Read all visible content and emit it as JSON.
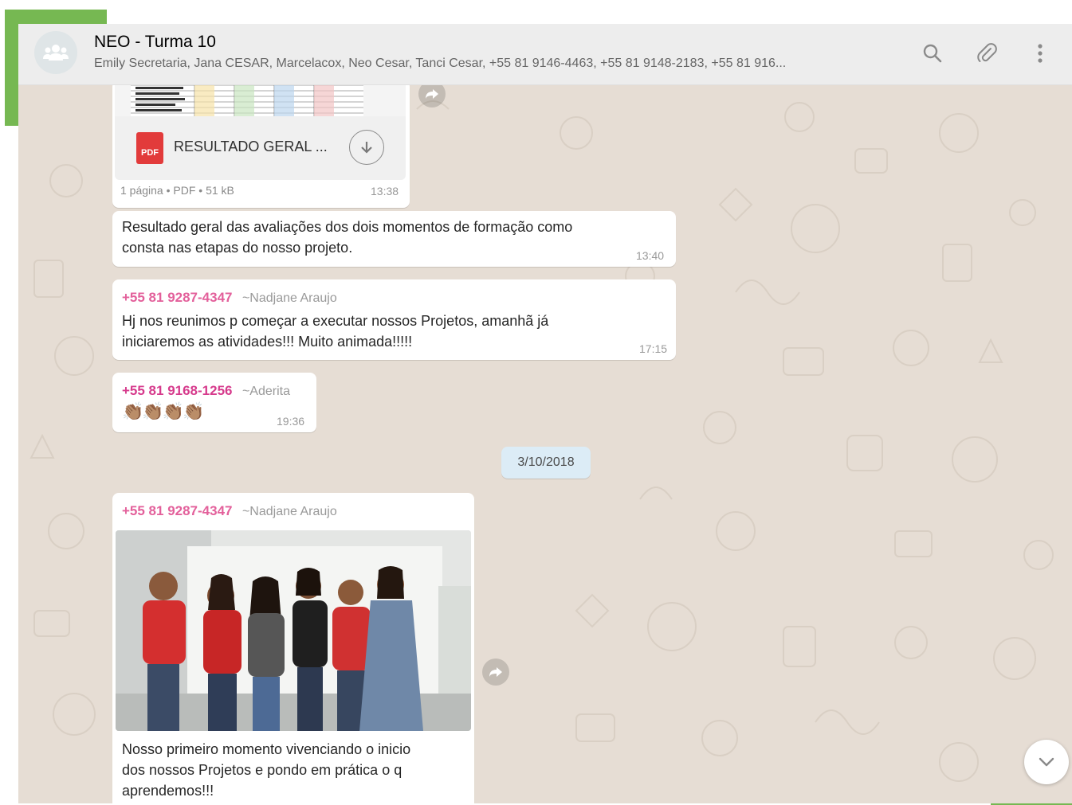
{
  "header": {
    "title": "NEO - Turma 10",
    "members": "Emily Secretaria, Jana CESAR, Marcelacox, Neo Cesar, Tanci Cesar, +55 81 9146-4463, +55 81 9148-2183, +55 81 916...",
    "icons": [
      "group-avatar-icon",
      "search-icon",
      "paperclip-icon",
      "more-vertical-icon"
    ]
  },
  "messages": {
    "document": {
      "file_name": "RESULTADO GERAL ...",
      "file_type_badge": "PDF",
      "meta": "1 página • PDF • 51 kB",
      "time": "13:38"
    },
    "doc_caption": {
      "text_line1": "Resultado geral das avaliações dos dois momentos de formação como",
      "text_line2": "consta nas etapas do nosso projeto.",
      "time": "13:40"
    },
    "nadjane_1": {
      "phone": "+55 81 9287-4347",
      "name": "~Nadjane Araujo",
      "text_line1": "Hj nos reunimos p começar a executar nossos Projetos, amanhã já",
      "text_line2": "iniciaremos as atividades!!! Muito animada!!!!!",
      "time": "17:15"
    },
    "aderita": {
      "phone": "+55 81 9168-1256",
      "name": "~Aderita",
      "emoji": "👏🏽👏🏽👏🏽👏🏽",
      "time": "19:36"
    },
    "date_divider": "3/10/2018",
    "nadjane_2": {
      "phone": "+55 81 9287-4347",
      "name": "~Nadjane Araujo",
      "caption_line1": "Nosso primeiro momento vivenciando o inicio",
      "caption_line2": "dos nossos Projetos e pondo em prática o q",
      "caption_line3": "aprendemos!!!"
    }
  },
  "colors": {
    "accent_green": "#76b852",
    "header_bg": "#ededed",
    "chat_bg": "#e6ddd4",
    "sender_pink": "#e3609b",
    "sender_magenta": "#d63a8c",
    "date_chip_bg": "#dcecf6"
  }
}
